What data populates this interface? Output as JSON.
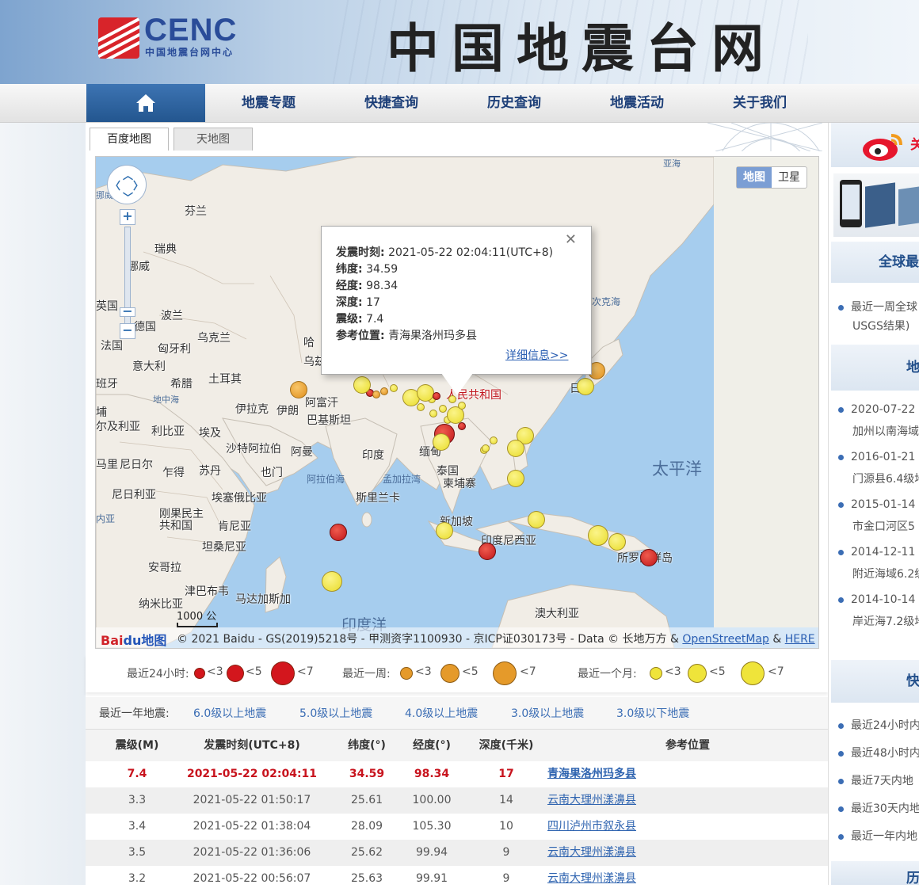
{
  "header": {
    "logo_text": "CENC",
    "logo_subtitle": "中国地震台网中心",
    "site_title": "中国地震台网"
  },
  "nav": {
    "items": [
      "地震专题",
      "快捷查询",
      "历史查询",
      "地震活动",
      "关于我们"
    ]
  },
  "map": {
    "tabs": [
      "百度地图",
      "天地图"
    ],
    "type_buttons": [
      "地图",
      "卫星"
    ],
    "popup": {
      "time_label": "发震时刻:",
      "time": "2021-05-22 02:04:11(UTC+8)",
      "lat_label": "纬度:",
      "lat": "34.59",
      "lon_label": "经度:",
      "lon": "98.34",
      "depth_label": "深度:",
      "depth": "17",
      "mag_label": "震级:",
      "mag": "7.4",
      "loc_label": "参考位置:",
      "loc": "青海果洛州玛多县",
      "more": "详细信息>>"
    },
    "scale": "1000 公",
    "attribution": {
      "logo": "Bai",
      "logo2": "du地图",
      "text": "© 2021 Baidu - GS(2019)5218号 - 甲测资字1100930 - 京ICP证030173号 - Data © 长地万方 &",
      "link1": "OpenStreetMap",
      "amp": "&",
      "link2": "HERE"
    },
    "labels": {
      "finland": "芬兰",
      "sweden": "瑞典",
      "norway": "挪威",
      "poland": "波兰",
      "germany": "德国",
      "france": "法国",
      "ukraine": "乌克兰",
      "hungary": "匈牙利",
      "italy": "意大利",
      "greece": "希腊",
      "turkey": "土耳其",
      "spain": "班牙",
      "england": "英国",
      "iraq": "伊拉克",
      "iran": "伊朗",
      "afghanistan": "阿富汗",
      "pakistan": "巴基斯坦",
      "china": "人民共和国",
      "mongolia_part": "哈",
      "uzbek_part": "乌兹",
      "algeria": "尔及利亚",
      "libya": "利比亚",
      "egypt": "埃及",
      "saudi": "沙特阿拉伯",
      "oman": "阿曼",
      "mali": "马里",
      "niger": "尼日尔",
      "chad": "乍得",
      "sudan": "苏丹",
      "yemen": "也门",
      "india": "印度",
      "myanmar": "缅甸",
      "thailand": "泰国",
      "cambodia": "柬埔寨",
      "srilanka": "斯里兰卡",
      "nigeria": "尼日利亚",
      "ethiopia": "埃塞俄比亚",
      "congo": "刚果民主\n共和国",
      "kenya": "肯尼亚",
      "tanzania": "坦桑尼亚",
      "angola": "安哥拉",
      "zimbabwe": "津巴布韦",
      "namibia": "纳米比亚",
      "madagascar": "马达加斯加",
      "singapore": "新加坡",
      "indonesia": "印度尼西亚",
      "solomon": "所罗门群岛",
      "australia": "澳大利亚",
      "japan": "日",
      "kamchatka": "次克海",
      "guinea_part": "内亚",
      "bangui": "埔",
      "mediterranean": "地中海",
      "arabian_sea": "阿拉伯海",
      "bengal": "孟加拉湾",
      "pacific": "太平洋",
      "indian_ocean": "印度洋",
      "arctic_top": "亚海",
      "norway_sea": "挪威"
    }
  },
  "legend": {
    "day_label": "最近24小时:",
    "week_label": "最近一周:",
    "month_label": "最近一个月:",
    "lt3": "<3",
    "lt5": "<5",
    "lt7": "<7"
  },
  "year_filter": {
    "label": "最近一年地震:",
    "options": [
      "6.0级以上地震",
      "5.0级以上地震",
      "4.0级以上地震",
      "3.0级以上地震",
      "3.0级以下地震"
    ]
  },
  "table": {
    "headers": [
      "震级(M)",
      "发震时刻(UTC+8)",
      "纬度(°)",
      "经度(°)",
      "深度(千米)",
      "参考位置"
    ],
    "rows": [
      [
        "7.4",
        "2021-05-22 02:04:11",
        "34.59",
        "98.34",
        "17",
        "青海果洛州玛多县"
      ],
      [
        "3.3",
        "2021-05-22 01:50:17",
        "25.61",
        "100.00",
        "14",
        "云南大理州漾濞县"
      ],
      [
        "3.4",
        "2021-05-22 01:38:04",
        "28.09",
        "105.30",
        "10",
        "四川泸州市叙永县"
      ],
      [
        "3.5",
        "2021-05-22 01:36:06",
        "25.62",
        "99.94",
        "9",
        "云南大理州漾濞县"
      ],
      [
        "3.2",
        "2021-05-22 00:56:07",
        "25.63",
        "99.91",
        "9",
        "云南大理州漾濞县"
      ]
    ]
  },
  "sidebar": {
    "weibo_head": "关",
    "global_head": "全球最",
    "global_items": [
      {
        "line1": "最近一周全球",
        "line2": "USGS结果)"
      }
    ],
    "quake_head": "地",
    "quake_items": [
      {
        "line1": "2020-07-22 1",
        "line2": "加州以南海域"
      },
      {
        "line1": "2016-01-21 0",
        "line2": "门源县6.4级地"
      },
      {
        "line1": "2015-01-14 1",
        "line2": "市金口河区5"
      },
      {
        "line1": "2014-12-11 0",
        "line2": "附近海域6.2级"
      },
      {
        "line1": "2014-10-14 1",
        "line2": "岸近海7.2级地"
      }
    ],
    "fast_head": "快",
    "fast_items": [
      "最近24小时内",
      "最近48小时内",
      "最近7天内地",
      "最近30天内地",
      "最近一年内地"
    ],
    "bottom_head": "历"
  }
}
